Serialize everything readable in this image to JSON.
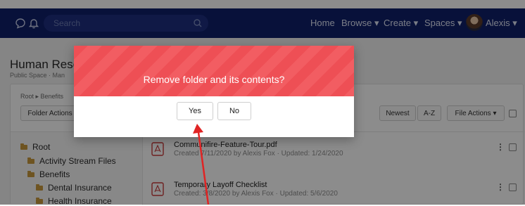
{
  "navbar": {
    "search_placeholder": "Search",
    "links": [
      "Home",
      "Browse ▾",
      "Create ▾",
      "Spaces ▾",
      "Alexis ▾"
    ]
  },
  "page": {
    "title": "Human Reso",
    "subtitle": "Public Space · Man"
  },
  "toolbar": {
    "breadcrumb": "Root ▸ Benefits",
    "folder_actions": "Folder Actions",
    "sort_newest": "Newest",
    "sort_az": "A-Z",
    "file_actions": "File Actions ▾"
  },
  "tree": [
    {
      "label": "Root"
    },
    {
      "label": "Activity Stream Files"
    },
    {
      "label": "Benefits"
    },
    {
      "label": "Dental Insurance"
    },
    {
      "label": "Health Insurance"
    }
  ],
  "files": [
    {
      "title": "Communifire-Feature-Tour.pdf",
      "meta": "Created 7/11/2020 by Alexis Fox · Updated: 1/24/2020"
    },
    {
      "title": "Temporary Layoff Checklist",
      "meta": "Created: 3/8/2020 by Alexis Fox · Updated: 5/6/2020"
    }
  ],
  "modal": {
    "message": "Remove folder and its contents?",
    "yes": "Yes",
    "no": "No"
  },
  "colors": {
    "navbar": "#0f1f6b",
    "modal_header": "#ee4f55",
    "arrow": "#e02424"
  }
}
